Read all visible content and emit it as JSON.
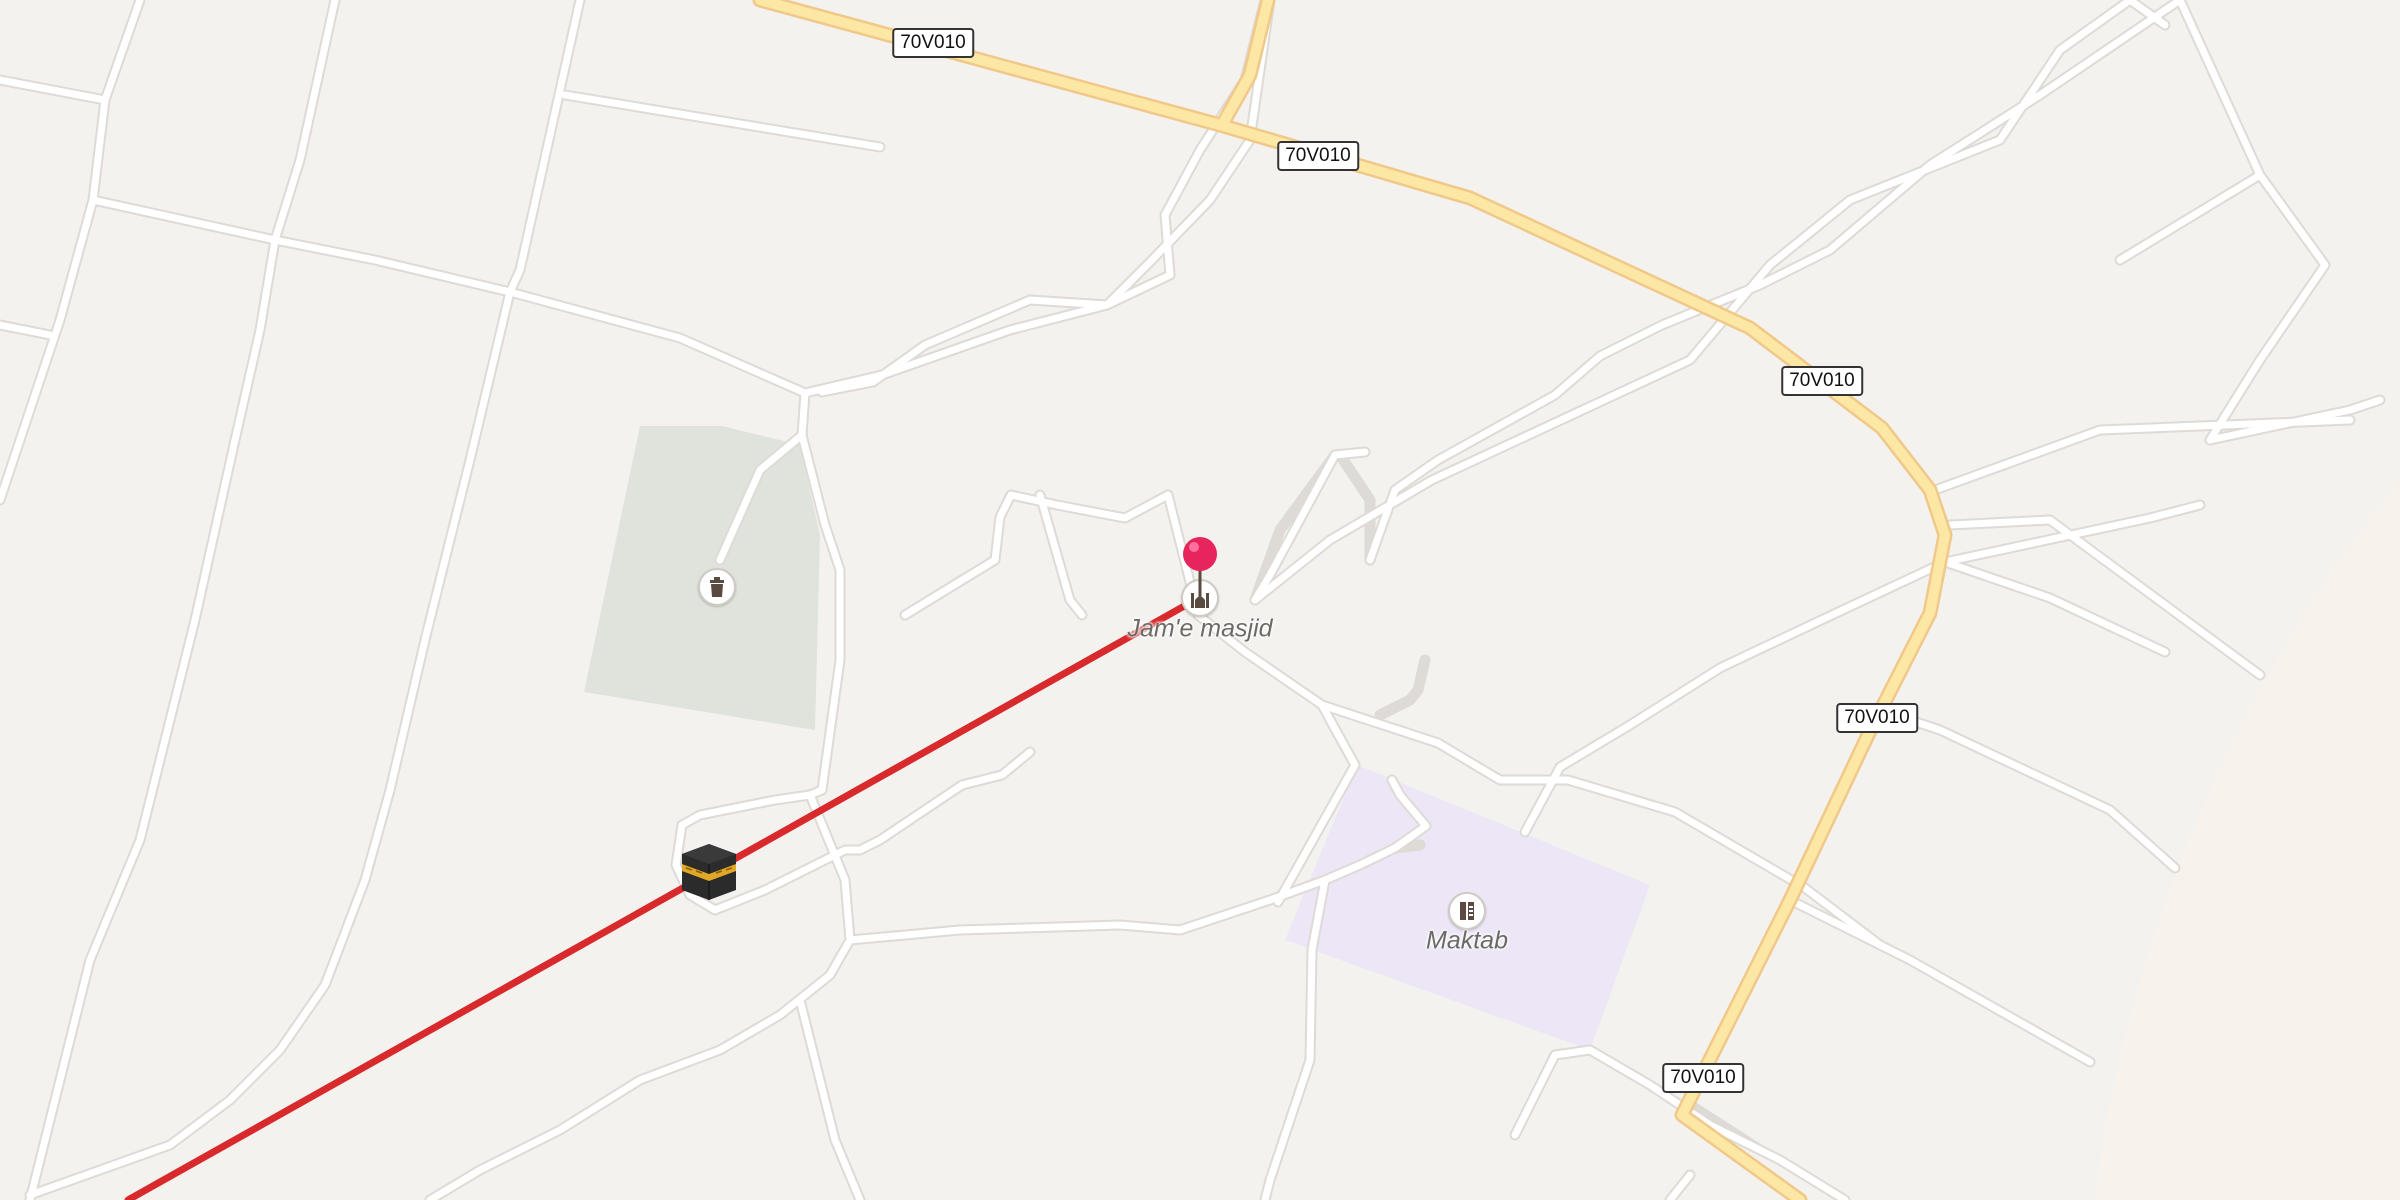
{
  "map": {
    "road_labels": [
      "70V010",
      "70V010",
      "70V010",
      "70V010",
      "70V010"
    ],
    "pois": {
      "mosque": {
        "name": "Jam'e masjid",
        "icon": "mosque-icon"
      },
      "school": {
        "name": "Maktab",
        "icon": "school-icon"
      },
      "cemetery": {
        "icon": "cemetery-icon"
      }
    },
    "qibla_marker": {
      "icon": "kaaba-icon"
    },
    "location_pin": {
      "icon": "location-pin-icon",
      "color": "#e8245d"
    },
    "colors": {
      "land": "#f4f2ef",
      "road": "#ffffff",
      "main_road": "#fde7a5",
      "main_road_casing": "#f0c98a",
      "cemetery_area": "#dfe3dc",
      "school_area": "#ede6f6",
      "qibla_line": "#d8292c"
    }
  }
}
